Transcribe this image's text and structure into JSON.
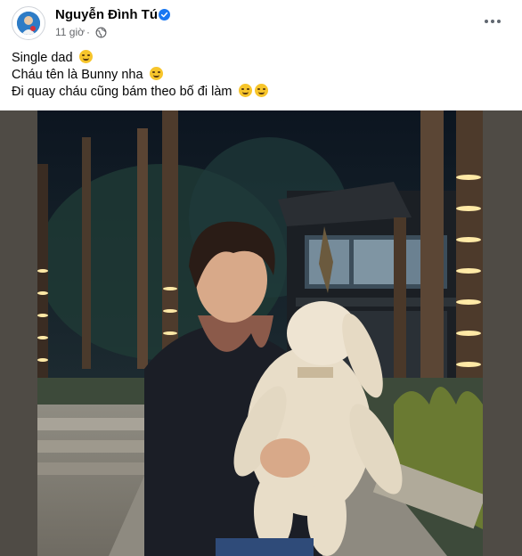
{
  "post": {
    "author": "Nguyễn Đình Tú",
    "time": "11 giờ",
    "separator": "·",
    "caption_lines": [
      "Single dad",
      "Cháu tên là Bunny nha",
      "Đi quay cháu cũng bám theo bố đi làm"
    ],
    "icons": {
      "verified": "verified-badge-icon",
      "audience": "globe-icon",
      "more": "more-options-icon"
    },
    "colors": {
      "name": "#050505",
      "meta": "#65676b",
      "verified": "#1877f2",
      "photo_frame": "#4f4b45"
    }
  }
}
